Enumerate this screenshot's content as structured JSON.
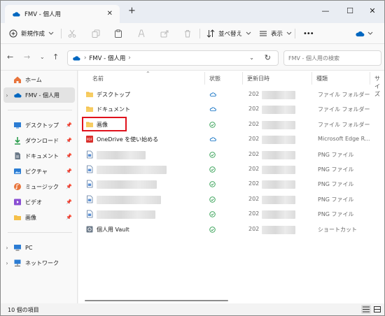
{
  "window": {
    "tab_title": "FMV - 個人用",
    "new_tab": "+",
    "tab_close": "✕",
    "minimize": "—",
    "maximize": "☐",
    "close": "✕"
  },
  "toolbar": {
    "new_label": "新規作成",
    "sort_label": "並べ替え",
    "view_label": "表示",
    "more_label": "•••"
  },
  "address": {
    "path": "FMV - 個人用",
    "separator": "›",
    "search_placeholder": "FMV - 個人用の検索"
  },
  "sidebar": {
    "items": [
      {
        "label": "ホーム",
        "icon": "home-icon"
      },
      {
        "label": "FMV - 個人用",
        "icon": "cloud-icon"
      },
      {
        "label": "デスクトップ",
        "icon": "desktop-icon",
        "pinned": true
      },
      {
        "label": "ダウンロード",
        "icon": "download-icon",
        "pinned": true
      },
      {
        "label": "ドキュメント",
        "icon": "documents-icon",
        "pinned": true
      },
      {
        "label": "ピクチャ",
        "icon": "pictures-icon",
        "pinned": true
      },
      {
        "label": "ミュージック",
        "icon": "music-icon",
        "pinned": true
      },
      {
        "label": "ビデオ",
        "icon": "video-icon",
        "pinned": true
      },
      {
        "label": "画像",
        "icon": "folder-icon",
        "pinned": true
      },
      {
        "label": "PC",
        "icon": "pc-icon"
      },
      {
        "label": "ネットワーク",
        "icon": "network-icon"
      }
    ]
  },
  "columns": {
    "name": "名前",
    "status": "状態",
    "modified": "更新日時",
    "type": "種類",
    "size": "サイズ"
  },
  "files": [
    {
      "name": "デスクトップ",
      "status": "cloud",
      "date": "202",
      "type": "ファイル フォルダー",
      "icon": "folder"
    },
    {
      "name": "ドキュメント",
      "status": "cloud",
      "date": "202",
      "type": "ファイル フォルダー",
      "icon": "folder"
    },
    {
      "name": "画像",
      "status": "check",
      "date": "202",
      "type": "ファイル フォルダー",
      "icon": "folder"
    },
    {
      "name": "OneDrive を使い始める",
      "status": "cloud",
      "date": "202",
      "type": "Microsoft Edge R...",
      "icon": "pdf"
    },
    {
      "name": "",
      "status": "check",
      "date": "202",
      "type": "PNG ファイル",
      "icon": "png"
    },
    {
      "name": "",
      "status": "check",
      "date": "202",
      "type": "PNG ファイル",
      "icon": "png"
    },
    {
      "name": "",
      "status": "check",
      "date": "202",
      "type": "PNG ファイル",
      "icon": "png"
    },
    {
      "name": "",
      "status": "check",
      "date": "202",
      "type": "PNG ファイル",
      "icon": "png"
    },
    {
      "name": "",
      "status": "check",
      "date": "202",
      "type": "PNG ファイル",
      "icon": "png"
    },
    {
      "name": "個人用 Vault",
      "status": "check",
      "date": "202",
      "type": "ショートカット",
      "icon": "vault"
    }
  ],
  "status_bar": {
    "item_count": "10 個の項目"
  },
  "colors": {
    "accent": "#0067c0",
    "folder": "#f5c04a",
    "highlight": "#e0121c",
    "check": "#2e9e4f"
  }
}
